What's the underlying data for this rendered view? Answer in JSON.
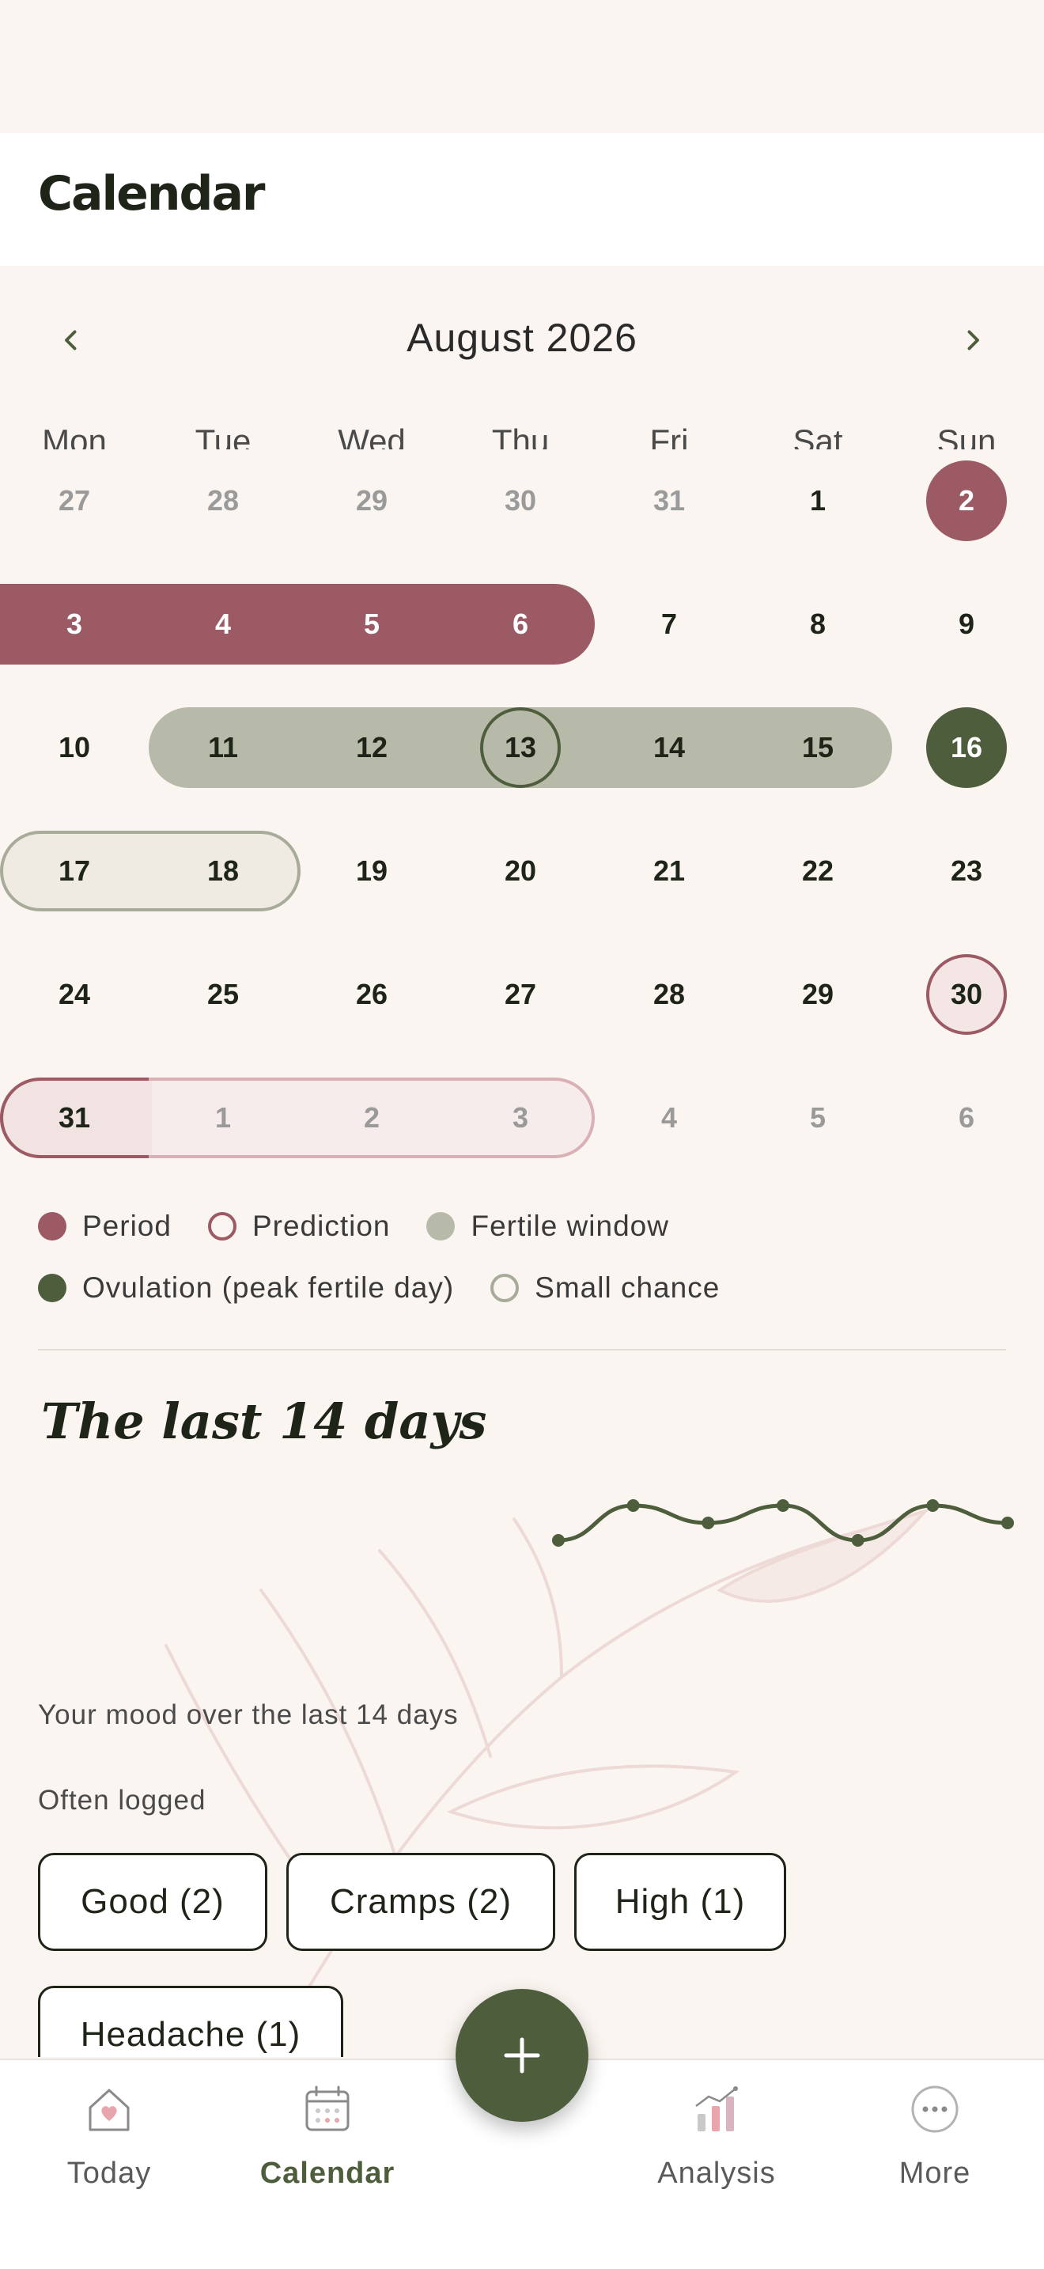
{
  "header": {
    "title": "Calendar"
  },
  "calendar": {
    "month_label": "August 2026",
    "weekdays": [
      "Mon",
      "Tue",
      "Wed",
      "Thu",
      "Fri",
      "Sat",
      "Sun"
    ],
    "weeks": [
      [
        "27",
        "28",
        "29",
        "30",
        "31",
        "1",
        "2"
      ],
      [
        "3",
        "4",
        "5",
        "6",
        "7",
        "8",
        "9"
      ],
      [
        "10",
        "11",
        "12",
        "13",
        "14",
        "15",
        "16"
      ],
      [
        "17",
        "18",
        "19",
        "20",
        "21",
        "22",
        "23"
      ],
      [
        "24",
        "25",
        "26",
        "27",
        "28",
        "29",
        "30"
      ],
      [
        "31",
        "1",
        "2",
        "3",
        "4",
        "5",
        "6"
      ]
    ],
    "states": {
      "period": [
        "2",
        "3",
        "4",
        "5",
        "6"
      ],
      "fertile_window": [
        "11",
        "12",
        "13",
        "14",
        "15"
      ],
      "ovulation": [
        "16"
      ],
      "small_chance": [
        "17",
        "18"
      ],
      "prediction": [
        "30",
        "31",
        "1",
        "2",
        "3"
      ]
    }
  },
  "legend": {
    "period": "Period",
    "prediction": "Prediction",
    "fertile": "Fertile window",
    "ovulation": "Ovulation (peak fertile day)",
    "small_chance": "Small chance"
  },
  "colors": {
    "period": "#9c5a64",
    "prediction_border": "#9c5a64",
    "prediction_fill": "#f3e6e4",
    "fertile": "#b8baa9",
    "ovulation": "#4e5e3c",
    "small_chance_border": "#a8ab99",
    "accent": "#4e5e3c"
  },
  "mood": {
    "title": "The last 14 days",
    "caption": "Your mood over the last 14 days",
    "chart_data": {
      "type": "line",
      "x": [
        1,
        2,
        3,
        4,
        5,
        6,
        7
      ],
      "values": [
        2,
        4,
        3,
        4,
        2,
        4,
        3
      ],
      "ylim": [
        1,
        5
      ]
    }
  },
  "often_logged": {
    "label": "Often logged",
    "chips": [
      "Good (2)",
      "Cramps (2)",
      "High (1)",
      "Headache (1)"
    ]
  },
  "fab": {
    "icon": "plus-icon"
  },
  "tabs": [
    {
      "label": "Today",
      "icon": "home-heart-icon"
    },
    {
      "label": "Calendar",
      "icon": "calendar-icon"
    },
    {
      "label": "Analysis",
      "icon": "bar-chart-icon"
    },
    {
      "label": "More",
      "icon": "more-icon"
    }
  ]
}
